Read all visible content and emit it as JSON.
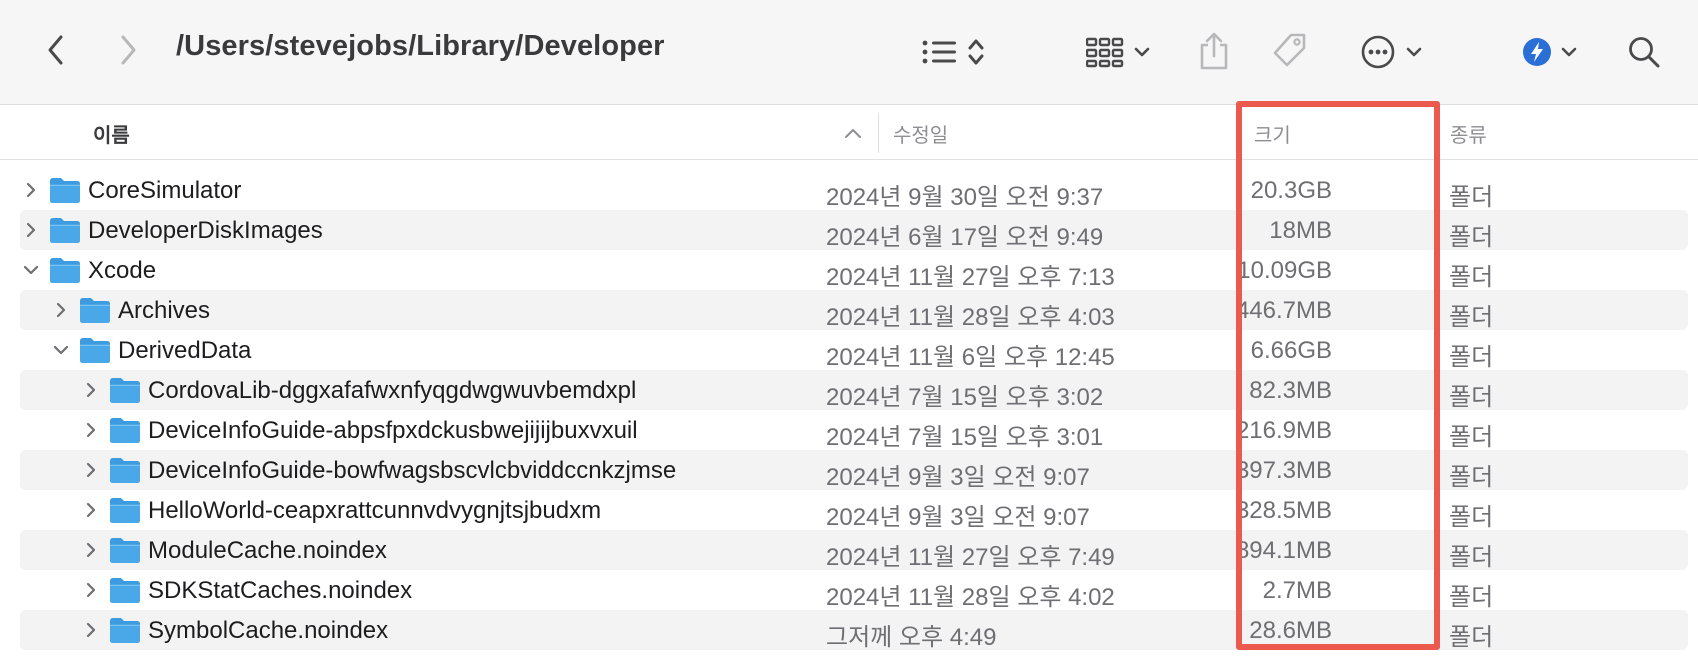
{
  "window": {
    "path_title": "/Users/stevejobs/Library/Developer"
  },
  "toolbar": {
    "icons": [
      "back-chevron-icon",
      "forward-chevron-icon",
      "list-view-icon",
      "sort-updown-icon",
      "group-grid-icon",
      "chevron-down-icon",
      "share-icon",
      "tag-icon",
      "more-ellipsis-icon",
      "app-badge-icon",
      "search-icon"
    ]
  },
  "columns": {
    "name": "이름",
    "modified": "수정일",
    "size": "크기",
    "kind": "종류"
  },
  "colors": {
    "highlight_border": "#ec5a4f",
    "folder_blue": "#4aa8e8",
    "zebra": "#f3f3f3"
  },
  "rows": [
    {
      "name": "CoreSimulator",
      "modified": "2024년 9월 30일 오전 9:37",
      "size": "20.3GB",
      "kind": "폴더",
      "depth": 0,
      "expanded": false
    },
    {
      "name": "DeveloperDiskImages",
      "modified": "2024년 6월 17일 오전 9:49",
      "size": "18MB",
      "kind": "폴더",
      "depth": 0,
      "expanded": false
    },
    {
      "name": "Xcode",
      "modified": "2024년 11월 27일 오후 7:13",
      "size": "10.09GB",
      "kind": "폴더",
      "depth": 0,
      "expanded": true
    },
    {
      "name": "Archives",
      "modified": "2024년 11월 28일 오후 4:03",
      "size": "446.7MB",
      "kind": "폴더",
      "depth": 1,
      "expanded": false
    },
    {
      "name": "DerivedData",
      "modified": "2024년 11월 6일 오후 12:45",
      "size": "6.66GB",
      "kind": "폴더",
      "depth": 1,
      "expanded": true
    },
    {
      "name": "CordovaLib-dggxafafwxnfyqgdwgwuvbemdxpl",
      "modified": "2024년 7월 15일 오후 3:02",
      "size": "82.3MB",
      "kind": "폴더",
      "depth": 2,
      "expanded": false
    },
    {
      "name": "DeviceInfoGuide-abpsfpxdckusbwejijijbuxvxuil",
      "modified": "2024년 7월 15일 오후 3:01",
      "size": "216.9MB",
      "kind": "폴더",
      "depth": 2,
      "expanded": false
    },
    {
      "name": "DeviceInfoGuide-bowfwagsbscvlcbviddccnkzjmse",
      "modified": "2024년 9월 3일 오전 9:07",
      "size": "397.3MB",
      "kind": "폴더",
      "depth": 2,
      "expanded": false
    },
    {
      "name": "HelloWorld-ceapxrattcunnvdvygnjtsjbudxm",
      "modified": "2024년 9월 3일 오전 9:07",
      "size": "328.5MB",
      "kind": "폴더",
      "depth": 2,
      "expanded": false
    },
    {
      "name": "ModuleCache.noindex",
      "modified": "2024년 11월 27일 오후 7:49",
      "size": "894.1MB",
      "kind": "폴더",
      "depth": 2,
      "expanded": false
    },
    {
      "name": "SDKStatCaches.noindex",
      "modified": "2024년 11월 28일 오후 4:02",
      "size": "2.7MB",
      "kind": "폴더",
      "depth": 2,
      "expanded": false
    },
    {
      "name": "SymbolCache.noindex",
      "modified": "그저께 오후 4:49",
      "size": "28.6MB",
      "kind": "폴더",
      "depth": 2,
      "expanded": false
    }
  ]
}
